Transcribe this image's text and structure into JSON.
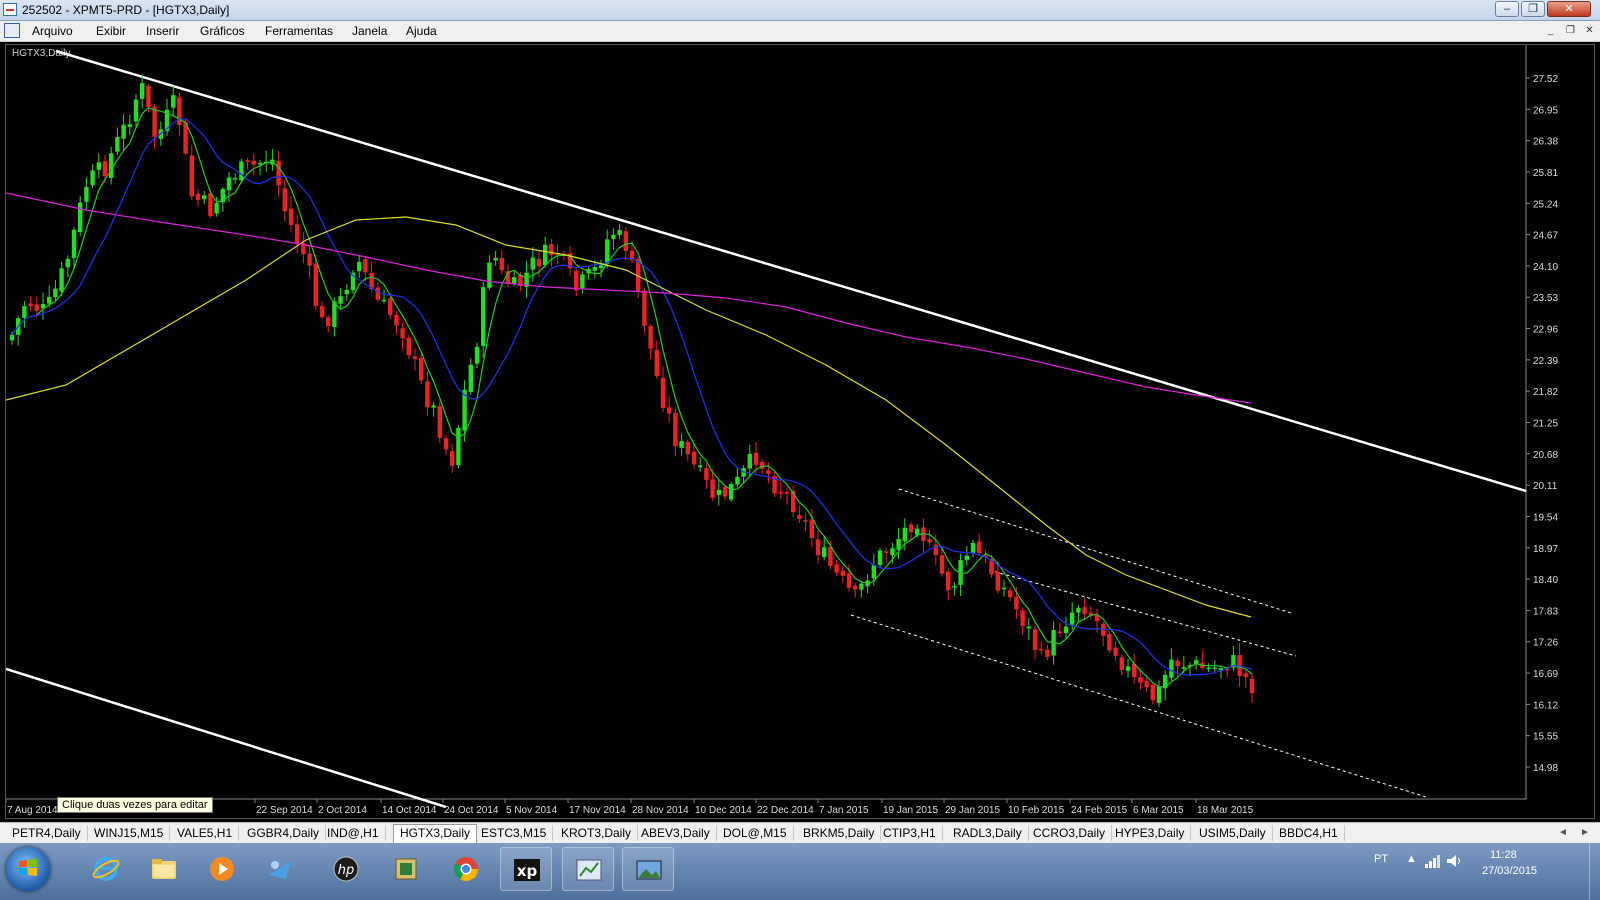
{
  "window": {
    "title": "252502 - XPMT5-PRD - [HGTX3,Daily]"
  },
  "menu": {
    "items": [
      "Arquivo",
      "Exibir",
      "Inserir",
      "Gráficos",
      "Ferramentas",
      "Janela",
      "Ajuda"
    ]
  },
  "chart": {
    "label": "HGTX3,Daily",
    "tooltip": "Clique duas vezes para editar",
    "price_labels": [
      "27.52",
      "26.95",
      "26.38",
      "25.81",
      "25.24",
      "24.67",
      "24.10",
      "23.53",
      "22.96",
      "22.39",
      "21.82",
      "21.25",
      "20.68",
      "20.11",
      "19.54",
      "18.97",
      "18.40",
      "17.83",
      "17.26",
      "16.69",
      "16.12",
      "15.55",
      "14.98"
    ],
    "date_labels": [
      "7 Aug 2014",
      "22 Sep 2014",
      "2 Oct 2014",
      "14 Oct 2014",
      "24 Oct 2014",
      "5 Nov 2014",
      "17 Nov 2014",
      "28 Nov 2014",
      "10 Dec 2014",
      "22 Dec 2014",
      "7 Jan 2015",
      "19 Jan 2015",
      "29 Jan 2015",
      "10 Feb 2015",
      "24 Feb 2015",
      "6 Mar 2015",
      "18 Mar 2015"
    ],
    "colors": {
      "bull": "#22dd22",
      "bear": "#ee2222",
      "ma_fast": "#22cc22",
      "ma_mid": "#2233ee",
      "ma_slow": "#dddd22",
      "ma_long": "#dd22dd",
      "trendline": "#ffffff"
    }
  },
  "tabs": {
    "items": [
      "PETR4,Daily",
      "WINJ15,M15",
      "VALE5,H1",
      "GGBR4,Daily",
      "IND@,H1",
      "HGTX3,Daily",
      "ESTC3,M15",
      "KROT3,Daily",
      "ABEV3,Daily",
      "DOL@,M15",
      "BRKM5,Daily",
      "CTIP3,H1",
      "RADL3,Daily",
      "CCRO3,Daily",
      "HYPE3,Daily",
      "USIM5,Daily",
      "BBDC4,H1"
    ],
    "active": "HGTX3,Daily"
  },
  "taskbar": {
    "icons": [
      "windows-start",
      "internet-explorer",
      "file-explorer",
      "media-player",
      "network-tool",
      "hp-tool",
      "archive-tool",
      "chrome",
      "xp-app",
      "metatrader",
      "photo-viewer"
    ],
    "tray": {
      "language": "PT",
      "time": "11:28",
      "date": "27/03/2015"
    }
  }
}
